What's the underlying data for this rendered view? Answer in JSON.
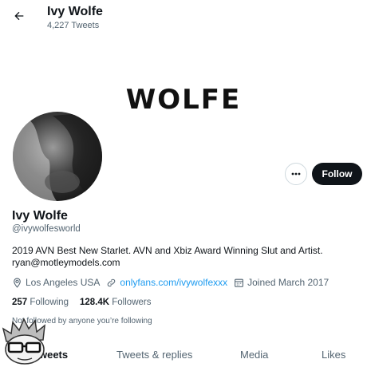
{
  "header": {
    "name": "Ivy Wolfe",
    "tweet_count": "4,227 Tweets"
  },
  "banner": {
    "text": "WOLFE"
  },
  "profile": {
    "name": "Ivy Wolfe",
    "handle": "@ivywolfesworld",
    "bio_lines": [
      "2019 AVN Best New Starlet. AVN and Xbiz Award Winning Slut and Artist.",
      "ryan@motleymodels.com"
    ],
    "location": "Los Angeles USA",
    "link": "onlyfans.com/ivywolfexxx",
    "joined": "Joined March 2017",
    "following_count": "257",
    "following_label": "Following",
    "followers_count": "128.4K",
    "followers_label": "Followers",
    "followed_by": "Not followed by anyone you’re following"
  },
  "actions": {
    "follow_label": "Follow"
  },
  "tabs": [
    {
      "label": "Tweets"
    },
    {
      "label": "Tweets & replies"
    },
    {
      "label": "Media"
    },
    {
      "label": "Likes"
    }
  ],
  "colors": {
    "accent": "#1d9bf0",
    "text_primary": "#0f1419",
    "text_secondary": "#536471",
    "follow_bg": "#0f1419"
  }
}
